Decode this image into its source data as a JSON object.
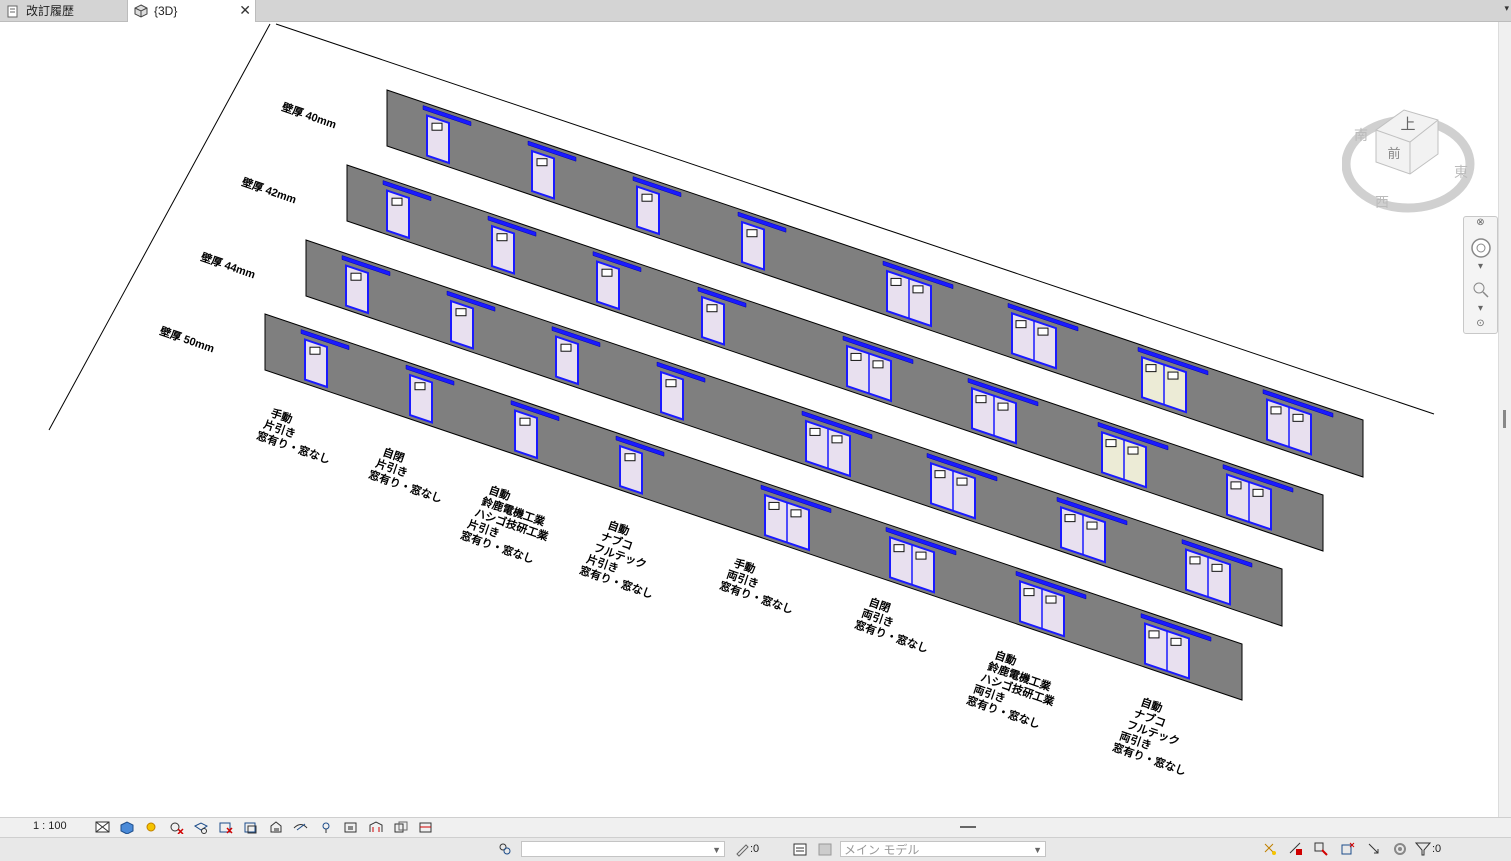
{
  "tabs": [
    {
      "label": "改訂履歴",
      "icon": "revision-history-icon"
    },
    {
      "label": "{3D}",
      "icon": "3d-view-icon",
      "active": true
    }
  ],
  "viewcube": {
    "top": "上",
    "front": "前",
    "left": "南",
    "right": "東",
    "back": "西"
  },
  "walls": [
    {
      "label": "壁厚 40mm"
    },
    {
      "label": "壁厚 42mm"
    },
    {
      "label": "壁厚 44mm"
    },
    {
      "label": "壁厚 50mm"
    }
  ],
  "door_columns": [
    {
      "lines": [
        "手動",
        "片引き",
        "窓有り・窓なし"
      ],
      "type": "single"
    },
    {
      "lines": [
        "自閉",
        "片引き",
        "窓有り・窓なし"
      ],
      "type": "single"
    },
    {
      "lines": [
        "自動",
        "鈴鹿電機工業",
        "ハシゴ技研工業",
        "片引き",
        "窓有り・窓なし"
      ],
      "type": "single"
    },
    {
      "lines": [
        "自動",
        "ナブコ",
        "フルテック",
        "片引き",
        "窓有り・窓なし"
      ],
      "type": "single"
    },
    {
      "lines": [
        "手動",
        "両引き",
        "窓有り・窓なし"
      ],
      "type": "double"
    },
    {
      "lines": [
        "自閉",
        "両引き",
        "窓有り・窓なし"
      ],
      "type": "double"
    },
    {
      "lines": [
        "自動",
        "鈴鹿電機工業",
        "ハシゴ技研工業",
        "両引き",
        "窓有り・窓なし"
      ],
      "type": "double"
    },
    {
      "lines": [
        "自動",
        "ナブコ",
        "フルテック",
        "両引き",
        "窓有り・窓なし"
      ],
      "type": "double"
    }
  ],
  "view_control": {
    "scale": "1 : 100"
  },
  "status": {
    "workset_placeholder": "",
    "editable_count": ":0",
    "model": "メイン モデル",
    "filter_count": ":0"
  },
  "colors": {
    "wall": "#7f7f7f",
    "door_frame": "#1a1aff",
    "door_panel": "#e8e0ef",
    "door_panel_alt": "#ecebd6"
  }
}
